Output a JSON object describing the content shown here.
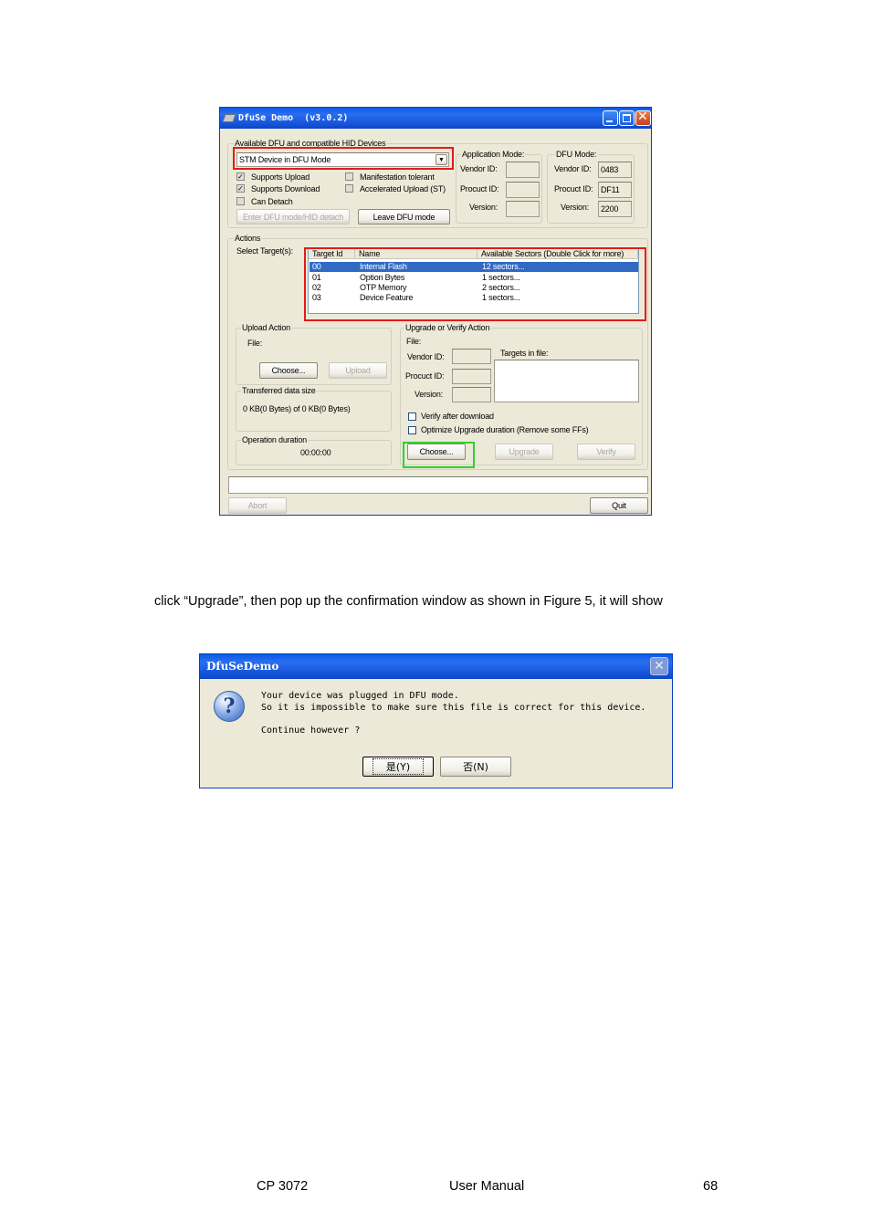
{
  "dfuse": {
    "title": "DfuSe Demo  (v3.0.2)",
    "devices_group": "Available DFU and compatible HID Devices",
    "device_selected": "STM Device in DFU Mode",
    "cb_supports_upload": "Supports Upload",
    "cb_supports_download": "Supports Download",
    "cb_can_detach": "Can Detach",
    "cb_manifestation": "Manifestation tolerant",
    "cb_accelerated": "Accelerated Upload (ST)",
    "enter_dfu": "Enter DFU mode/HID detach",
    "leave_dfu": "Leave DFU mode",
    "app_mode": {
      "label": "Application Mode:",
      "vendor": "Vendor ID:",
      "product": "Procuct ID:",
      "version": "Version:"
    },
    "dfu_mode": {
      "label": "DFU Mode:",
      "vendor": "Vendor ID:",
      "product": "Procuct ID:",
      "version": "Version:",
      "vendor_val": "0483",
      "product_val": "DF11",
      "version_val": "2200"
    },
    "actions": "Actions",
    "select_target": "Select Target(s):",
    "list_headers": [
      "Target Id",
      "Name",
      "Available Sectors (Double Click for more)"
    ],
    "targets": [
      {
        "id": "00",
        "name": "Internal Flash",
        "sectors": "12 sectors..."
      },
      {
        "id": "01",
        "name": "Option Bytes",
        "sectors": "1 sectors..."
      },
      {
        "id": "02",
        "name": "OTP Memory",
        "sectors": "2 sectors..."
      },
      {
        "id": "03",
        "name": "Device Feature",
        "sectors": "1 sectors..."
      }
    ],
    "upload_action": "Upload Action",
    "file_label": "File:",
    "choose": "Choose...",
    "upload": "Upload",
    "transferred_label": "Transferred data size",
    "transferred_value": "0 KB(0 Bytes) of 0 KB(0 Bytes)",
    "duration_label": "Operation duration",
    "duration_value": "00:00:00",
    "upgrade_group": "Upgrade or Verify Action",
    "file2": "File:",
    "vendor2": "Vendor ID:",
    "product2": "Procuct ID:",
    "version2": "Version:",
    "targets_in_file": "Targets in file:",
    "verify_after": "Verify after download",
    "optimize": "Optimize Upgrade duration (Remove some FFs)",
    "choose2": "Choose...",
    "upgrade": "Upgrade",
    "verify": "Verify",
    "abort": "Abort",
    "quit": "Quit"
  },
  "body_text": "click “Upgrade”, then pop up the confirmation window as shown in Figure 5, it will show",
  "dialog": {
    "title": "DfuSeDemo",
    "line1": "Your device was plugged in DFU mode.",
    "line2": "So it is impossible to make sure this file is correct for this device.",
    "line3": "Continue however ?",
    "yes": "是(Y)",
    "no": "否(N)"
  },
  "footer": {
    "left": "CP 3072",
    "center": "User Manual",
    "page": "68"
  }
}
